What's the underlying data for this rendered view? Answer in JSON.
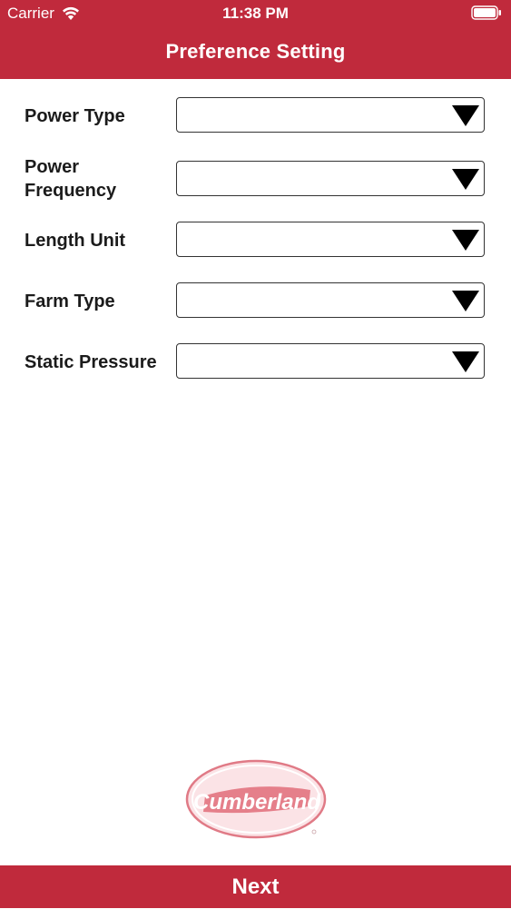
{
  "status_bar": {
    "carrier": "Carrier",
    "time": "11:38 PM"
  },
  "header": {
    "title": "Preference Setting",
    "color": "#c02a3c"
  },
  "form": {
    "fields": [
      {
        "label": "Power Type",
        "value": ""
      },
      {
        "label": "Power\nFrequency",
        "value": ""
      },
      {
        "label": "Length Unit",
        "value": ""
      },
      {
        "label": "Farm Type",
        "value": ""
      },
      {
        "label": "Static Pressure",
        "value": ""
      }
    ]
  },
  "logo": {
    "text": "Cumberland",
    "icon": "cumberland-logo"
  },
  "footer": {
    "next_label": "Next"
  }
}
